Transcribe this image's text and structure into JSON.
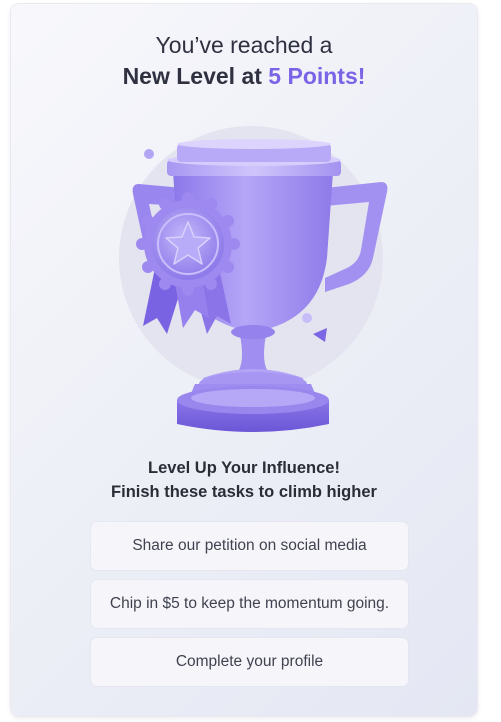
{
  "header": {
    "line1": "You’ve reached a",
    "line2_prefix": "New Level at ",
    "line2_accent": "5 Points!"
  },
  "subheading": {
    "line1": "Level Up Your Influence!",
    "line2": "Finish these tasks to climb higher"
  },
  "tasks": [
    {
      "label": "Share our petition on social media"
    },
    {
      "label": "Chip in $5 to keep the momentum going."
    },
    {
      "label": "Complete your profile"
    }
  ],
  "colors": {
    "accent": "#7b63e6",
    "trophy": "#a795f2",
    "trophy_dark": "#7964e0",
    "card_bg": "#eef0f7"
  },
  "illustration": {
    "icon": "trophy-with-star-ribbon-icon"
  }
}
